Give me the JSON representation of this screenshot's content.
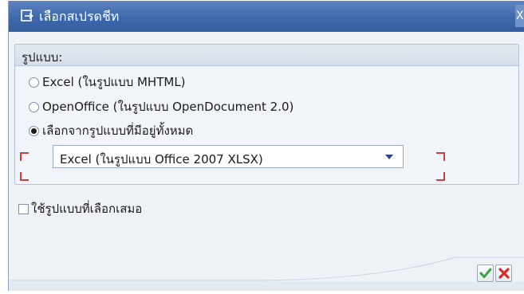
{
  "dialog": {
    "title": "เลือกสเปรดชีท",
    "close_label": "X"
  },
  "format_group": {
    "title": "รูปแบบ:",
    "options": [
      {
        "label": "Excel (ในรูปแบบ MHTML)",
        "selected": false
      },
      {
        "label": "OpenOffice (ในรูปแบบ OpenDocument 2.0)",
        "selected": false
      },
      {
        "label": "เลือกจากรูปแบบที่มีอยู่ทั้งหมด",
        "selected": true
      }
    ],
    "select_value": "Excel (ในรูปแบบ Office 2007 XLSX)"
  },
  "always_use": {
    "label": "ใช้รูปแบบที่เลือกเสมอ",
    "checked": false
  },
  "buttons": {
    "ok_icon": "green-checkmark-icon",
    "cancel_icon": "red-cross-icon"
  },
  "colors": {
    "titlebar": "#3e68ab",
    "ok": "#3aa53a",
    "cancel": "#d22b2b",
    "focus_mark": "#d23c3c"
  }
}
